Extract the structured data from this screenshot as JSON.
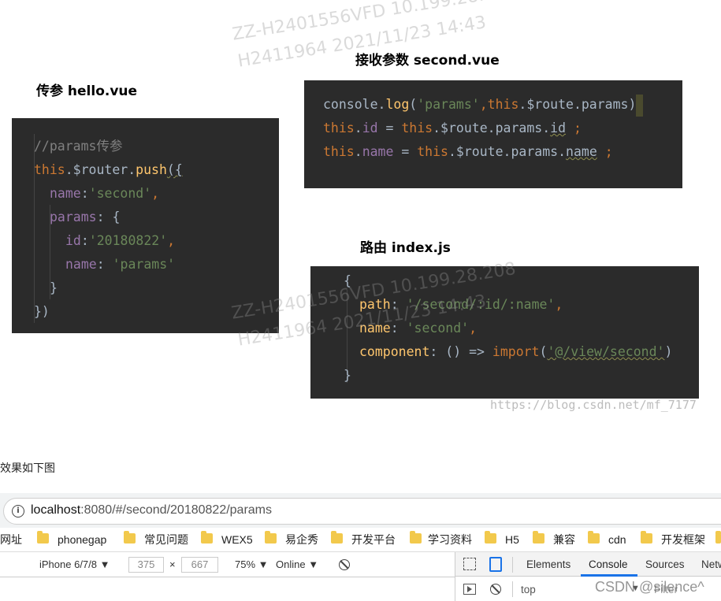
{
  "headings": {
    "hello": "传参 hello.vue",
    "second": "接收参数 second.vue",
    "router": "路由  index.js"
  },
  "code_hello": {
    "l1_comment": "//params传参",
    "l2_this": "this",
    "l2_router": ".$router.",
    "l2_push": "push",
    "l2_paren": "({",
    "l3_key": "name",
    "l3_colon": ":",
    "l3_val": "'second'",
    "l3_comma": ",",
    "l4_key": "params",
    "l4_rest": ": {",
    "l5_key": "id",
    "l5_colon": ":",
    "l5_val": "'20180822'",
    "l5_comma": ",",
    "l6_key": "name",
    "l6_colon": ": ",
    "l6_val": "'params'",
    "l7": "}",
    "l8": "})"
  },
  "code_second": {
    "l1_console": "console.",
    "l1_log": "log",
    "l1_open": "(",
    "l1_str": "'params'",
    "l1_comma": ",",
    "l1_this": "this",
    "l1_rest": ".$route.params)",
    "l2_this": "this",
    "l2_dot": ".",
    "l2_id": "id",
    "l2_eq": " = ",
    "l2_this2": "this",
    "l2_rest": ".$route.params.",
    "l2_id2": "id",
    "l2_semi": " ;",
    "l3_this": "this",
    "l3_dot": ".",
    "l3_name": "name",
    "l3_eq": " = ",
    "l3_this2": "this",
    "l3_rest": ".$route.params.",
    "l3_name2": "name",
    "l3_semi": " ;"
  },
  "code_router": {
    "l1": "{",
    "l2_key": "path",
    "l2_colon": ": ",
    "l2_val": "'/second/:id/:name'",
    "l2_comma": ",",
    "l3_key": "name",
    "l3_colon": ": ",
    "l3_val": "'second'",
    "l3_comma": ",",
    "l4_key": "component",
    "l4_mid": ": () => ",
    "l4_import": "import",
    "l4_open": "(",
    "l4_val": "'@/view/second'",
    "l4_close": ")",
    "l5": "}"
  },
  "watermarks": {
    "w1": "ZZ-H2401556VFD  10.199.28.208",
    "w2": "H2411964 2021/11/23 14:43",
    "w3": "ZZ-H2401556VFD  10.199.28.208",
    "w4": "H2411964 2021/11/23 14:43",
    "w5": "ZZ-H2401556VFD  10.199.28.208",
    "w6": "H2411964 2021/11/23 14:43",
    "csdn_url": "https://blog.csdn.net/mf_7177",
    "csdn_mark": "CSDN @silence^"
  },
  "caption": "效果如下图",
  "browser": {
    "url_host": "localhost",
    "url_rest": ":8080/#/second/20180822/params",
    "bookmarks": [
      "网址",
      "phonegap",
      "常见问题",
      "WEX5",
      "易企秀",
      "开发平台",
      "学习资料",
      "H5",
      "兼容",
      "cdn",
      "开发框架"
    ],
    "device": "iPhone 6/7/8 ▼",
    "width": "375",
    "times": "×",
    "height": "667",
    "zoom": "75% ▼",
    "network": "Online ▼"
  },
  "devtools": {
    "tabs": [
      "Elements",
      "Console",
      "Sources",
      "Netw"
    ],
    "active_tab": "Console",
    "context": "top",
    "filter_placeholder": "Filter"
  },
  "colors": {
    "code_bg": "#2b2b2b",
    "keyword": "#cc7832",
    "string": "#6a8759",
    "property": "#9876aa",
    "function": "#ffc66d",
    "accent": "#1a73e8"
  }
}
